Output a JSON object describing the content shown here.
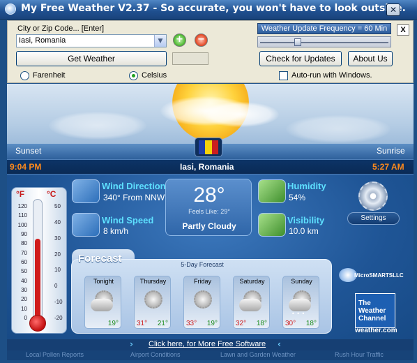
{
  "window": {
    "title": "My Free Weather V2.37 -  So accurate, you won't have to look outside.",
    "close_glyph": "✕"
  },
  "controls": {
    "city_label": "City or Zip Code...  [Enter]",
    "city_value": "Iasi, Romania",
    "get_weather_label": "Get Weather",
    "add_glyph": "+",
    "remove_glyph": "−",
    "units": [
      {
        "label": "Farenheit",
        "selected": false
      },
      {
        "label": "Celsius",
        "selected": true
      }
    ],
    "frequency_label": "Weather Update Frequency = 60 Min",
    "close_panel_glyph": "X",
    "check_updates_label": "Check for Updates",
    "about_label": "About Us",
    "autorun_label": "Auto-run with Windows.",
    "autorun_checked": false
  },
  "flag_colors": [
    "#1f3fa8",
    "#f5d20a",
    "#cc1f1f"
  ],
  "sun": {
    "sunset_label": "Sunset",
    "sunrise_label": "Sunrise",
    "sunset_time": "9:04 PM",
    "sunrise_time": "5:27 AM"
  },
  "location": "Iasi, Romania",
  "thermometer": {
    "f_label": "°F",
    "c_label": "°C",
    "f_ticks": [
      "120",
      "110",
      "100",
      "90",
      "80",
      "70",
      "60",
      "50",
      "40",
      "30",
      "20",
      "10",
      "0"
    ],
    "c_ticks": [
      "50",
      "40",
      "30",
      "20",
      "10",
      "0",
      "-10",
      "-20"
    ],
    "level_celsius": 28
  },
  "conditions": {
    "temperature": "28°",
    "feels_like": "Feels Like: 29°",
    "description": "Partly Cloudy",
    "wind_direction_title": "Wind Direction",
    "wind_direction_value": "340° From NNW",
    "wind_speed_title": "Wind Speed",
    "wind_speed_value": "8 km/h",
    "humidity_title": "Humidity",
    "humidity_value": "54%",
    "visibility_title": "Visibility",
    "visibility_value": "10.0 km"
  },
  "settings_label": "Settings",
  "forecast": {
    "title": "Forecast",
    "subtitle": "5-Day Forecast",
    "days": [
      {
        "name": "Tonight",
        "hi": "",
        "lo": "19°",
        "icon": "partly-cloudy-icon"
      },
      {
        "name": "Thursday",
        "hi": "31°",
        "lo": "21°",
        "icon": "sunny-icon"
      },
      {
        "name": "Friday",
        "hi": "33°",
        "lo": "19°",
        "icon": "sunny-icon"
      },
      {
        "name": "Saturday",
        "hi": "32°",
        "lo": "18°",
        "icon": "partly-cloudy-icon"
      },
      {
        "name": "Sunday",
        "hi": "30°",
        "lo": "18°",
        "icon": "thunderstorm-icon"
      }
    ]
  },
  "branding": {
    "microsmarts": "MicroSMARTSLLC",
    "weather_channel": "The Weather Channel",
    "weather_com": "weather.com"
  },
  "footer": {
    "more_link": "Click here, for More Free Software",
    "links": [
      "Local Pollen Reports",
      "Airport Conditions",
      "Lawn and Garden Weather",
      "Rush Hour Traffic"
    ]
  }
}
